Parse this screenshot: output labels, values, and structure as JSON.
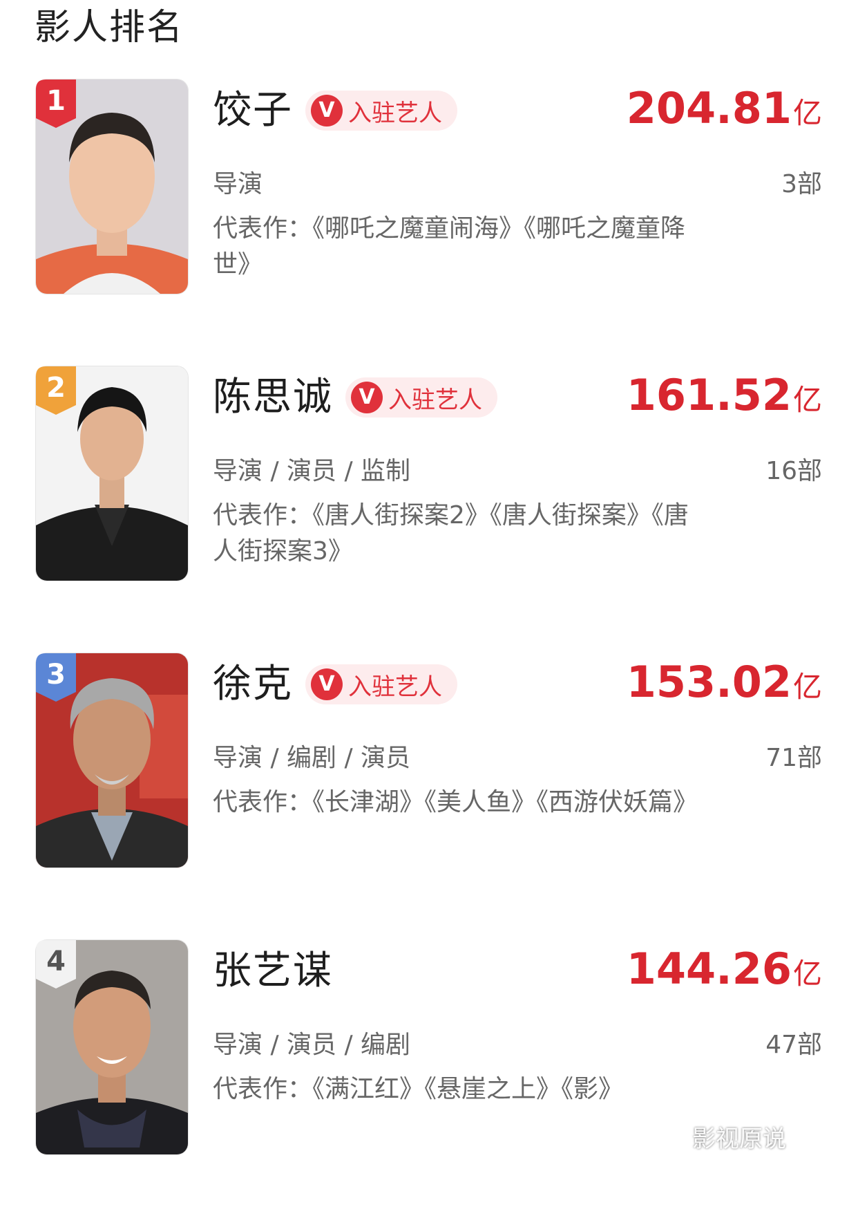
{
  "section_title": "影人排名",
  "artist_badge_label": "入驻艺人",
  "badge_icon_letter": "V",
  "accent_color": "#d8262f",
  "watermark": "影视原说",
  "entries": [
    {
      "rank": "1",
      "rank_color": "#e0313b",
      "name": "饺子",
      "has_badge": true,
      "box_office": "204.81",
      "unit": "亿",
      "roles": "导演",
      "count": "3部",
      "works": "代表作：《哪吒之魔童闹海》《哪吒之魔童降世》"
    },
    {
      "rank": "2",
      "rank_color": "#f0a23a",
      "name": "陈思诚",
      "has_badge": true,
      "box_office": "161.52",
      "unit": "亿",
      "roles": "导演 / 演员 / 监制",
      "count": "16部",
      "works": "代表作：《唐人街探案2》《唐人街探案》《唐人街探案3》"
    },
    {
      "rank": "3",
      "rank_color": "#5b86d6",
      "name": "徐克",
      "has_badge": true,
      "box_office": "153.02",
      "unit": "亿",
      "roles": "导演 / 编剧 / 演员",
      "count": "71部",
      "works": "代表作：《长津湖》《美人鱼》《西游伏妖篇》"
    },
    {
      "rank": "4",
      "rank_color": "#f2f2f2",
      "name": "张艺谋",
      "has_badge": false,
      "box_office": "144.26",
      "unit": "亿",
      "roles": "导演 / 演员 / 编剧",
      "count": "47部",
      "works": "代表作：《满江红》《悬崖之上》《影》"
    }
  ]
}
